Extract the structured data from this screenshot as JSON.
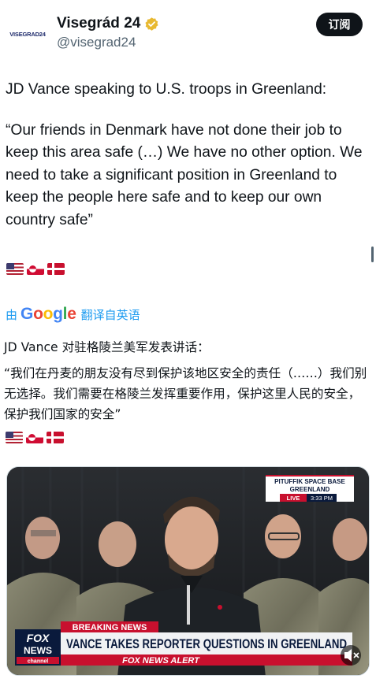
{
  "author": {
    "display_name": "Visegrád 24",
    "handle": "@visegrad24",
    "avatar_text": "VISEGRAD24",
    "verified": true
  },
  "subscribe_label": "订阅",
  "tweet": {
    "paragraph1": "JD Vance speaking to U.S. troops in Greenland:",
    "paragraph2": "“Our friends in Denmark have not done their job to keep this area safe (…) We have no other option. We need to take a significant position in Greenland to keep the people here safe and to keep our own country safe”",
    "flags": [
      "us-flag",
      "greenland-flag",
      "denmark-flag"
    ]
  },
  "translation": {
    "by_label": "由",
    "provider": "Google",
    "action_label": "翻译自英语",
    "paragraph1": "JD Vance 对驻格陵兰美军发表讲话：",
    "paragraph2": "“我们在丹麦的朋友没有尽到保护该地区安全的责任（……）我们别无选择。我们需要在格陵兰发挥重要作用，保护这里人民的安全，保护我们国家的安全”"
  },
  "video": {
    "location_line1": "PITUFFIK SPACE BASE",
    "location_line2": "GREENLAND",
    "live_label": "LIVE",
    "time": "3:33 PM",
    "breaking_label": "BREAKING NEWS",
    "headline": "VANCE TAKES REPORTER QUESTIONS IN GREENLAND",
    "alert_label": "FOX NEWS ALERT",
    "channel_logo_line1": "FOX",
    "channel_logo_line2": "NEWS",
    "channel_logo_line3": "channel"
  },
  "colors": {
    "link_blue": "#1d9bf0",
    "breaking_red": "#c8102e",
    "headline_bar": "#f1f2f4",
    "verified_gold": "#e8b931"
  }
}
